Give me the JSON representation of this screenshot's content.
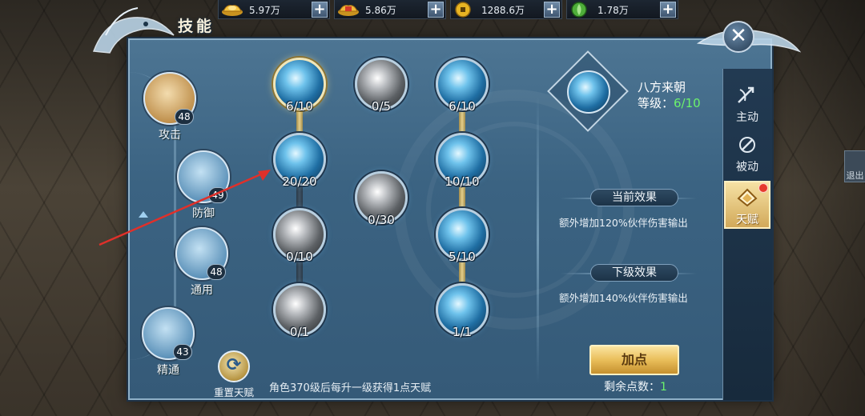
{
  "currencies": [
    {
      "icon": "gold-ingot-icon",
      "value": "5.97万"
    },
    {
      "icon": "bound-gold-ingot-icon",
      "value": "5.86万"
    },
    {
      "icon": "coin-icon",
      "value": "1288.6万"
    },
    {
      "icon": "jade-icon",
      "value": "1.78万"
    }
  ],
  "panel": {
    "title": "技能"
  },
  "categories": [
    {
      "label": "攻击",
      "level": "48"
    },
    {
      "label": "防御",
      "level": "49"
    },
    {
      "label": "通用",
      "level": "48"
    },
    {
      "label": "精通",
      "level": "43"
    }
  ],
  "tree": {
    "nodes": [
      {
        "count": "6/10",
        "style": "blue",
        "selected": true
      },
      {
        "count": "0/5",
        "style": "grey"
      },
      {
        "count": "6/10",
        "style": "blue"
      },
      {
        "count": "20/20",
        "style": "blue"
      },
      {
        "count": "0/30",
        "style": "grey"
      },
      {
        "count": "10/10",
        "style": "blue"
      },
      {
        "count": "0/10",
        "style": "grey"
      },
      {
        "count": "5/10",
        "style": "blue"
      },
      {
        "count": "0/1",
        "style": "grey"
      },
      {
        "count": "1/1",
        "style": "blue"
      }
    ]
  },
  "detail": {
    "name": "八方来朝",
    "level_label": "等级：",
    "level_value": "6/10",
    "current_effect_title": "当前效果",
    "current_effect_text": "额外增加120%伙伴伤害输出",
    "next_effect_title": "下级效果",
    "next_effect_text": "额外增加140%伙伴伤害输出"
  },
  "actions": {
    "add_point": "加点",
    "remaining_label": "剩余点数：",
    "remaining_value": "1",
    "reset_label": "重置天赋",
    "hint": "角色370级后每升一级获得1点天赋"
  },
  "tabs": [
    {
      "label": "主动",
      "icon": "active-skill-icon",
      "active": false
    },
    {
      "label": "被动",
      "icon": "passive-skill-icon",
      "active": false
    },
    {
      "label": "天赋",
      "icon": "talent-icon",
      "active": true,
      "badge": true
    }
  ],
  "background": {
    "exit_label": "退出"
  },
  "colors": {
    "accent_green": "#6cf26c",
    "gold_button": "#e9be5a",
    "alert_red": "#e53a2c"
  }
}
